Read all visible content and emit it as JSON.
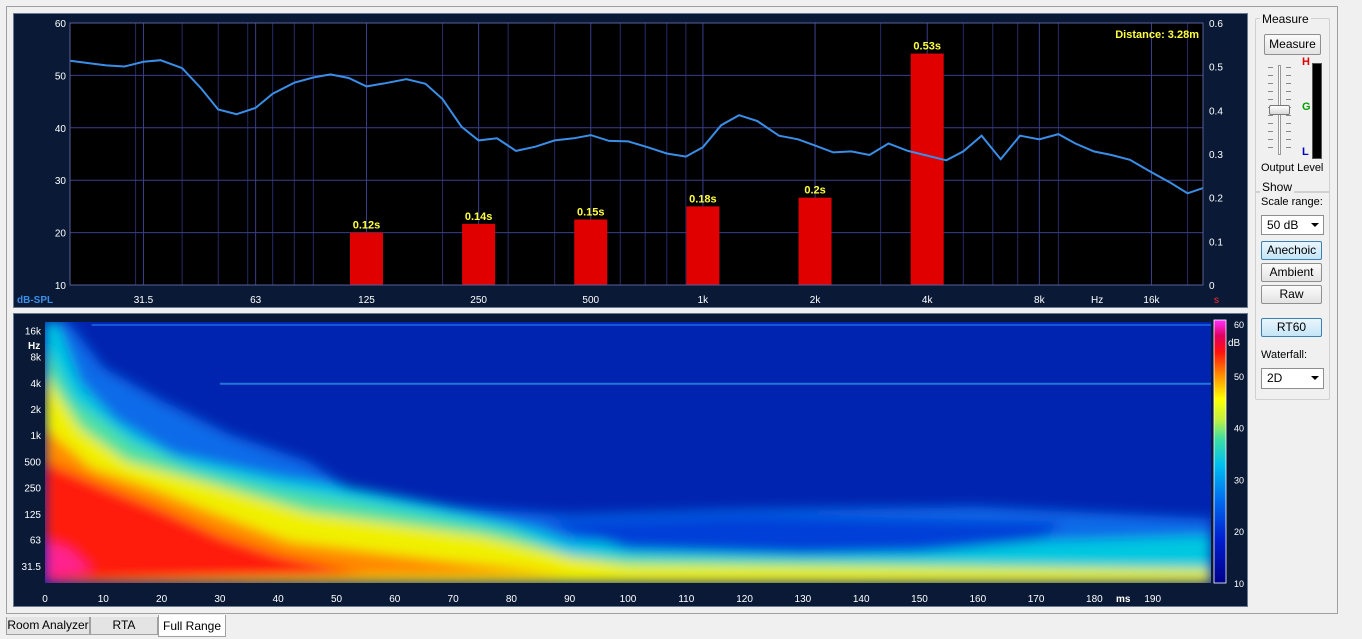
{
  "top_chart": {
    "annotation": "Distance: 3.28m",
    "left_unit": "dB-SPL",
    "freq_unit": "Hz",
    "right_unit": "s",
    "left_ticks": [
      "60",
      "50",
      "40",
      "30",
      "20",
      "10"
    ],
    "right_ticks": [
      "0.6",
      "0.5",
      "0.4",
      "0.3",
      "0.2",
      "0.1",
      "0"
    ],
    "freq_ticks": [
      "31.5",
      "63",
      "125",
      "250",
      "500",
      "1k",
      "2k",
      "4k",
      "8k",
      "16k"
    ]
  },
  "chart_data": [
    {
      "type": "line",
      "xscale": "log",
      "xlim": [
        20,
        22000
      ],
      "ylim": [
        10,
        60
      ],
      "x": [
        20,
        25,
        28,
        31.5,
        35,
        40,
        45,
        50,
        56,
        63,
        70,
        80,
        90,
        100,
        112,
        125,
        140,
        160,
        180,
        200,
        225,
        250,
        280,
        315,
        355,
        400,
        450,
        500,
        560,
        630,
        710,
        800,
        900,
        1000,
        1120,
        1250,
        1400,
        1600,
        1800,
        2000,
        2240,
        2500,
        2800,
        3150,
        3550,
        4000,
        4500,
        5000,
        5600,
        6300,
        7100,
        8000,
        9000,
        10000,
        11200,
        12500,
        14000,
        16000,
        18000,
        20000,
        22000
      ],
      "y": [
        52.8,
        51.9,
        51.7,
        52.6,
        52.9,
        51.4,
        47.5,
        43.5,
        42.6,
        43.8,
        46.5,
        48.6,
        49.6,
        50.2,
        49.5,
        47.9,
        48.5,
        49.3,
        48.4,
        45.5,
        40.2,
        37.6,
        38.0,
        35.6,
        36.4,
        37.6,
        38.0,
        38.6,
        37.5,
        37.4,
        36.3,
        35.1,
        34.5,
        36.3,
        40.5,
        42.4,
        41.3,
        38.5,
        37.8,
        36.6,
        35.3,
        35.5,
        34.8,
        37.0,
        35.6,
        34.7,
        33.8,
        35.5,
        38.5,
        34.0,
        38.5,
        37.8,
        38.8,
        37.0,
        35.5,
        34.8,
        33.9,
        31.5,
        29.5,
        27.5,
        28.5
      ]
    },
    {
      "type": "bar",
      "categories": [
        "125",
        "250",
        "500",
        "1k",
        "2k",
        "4k"
      ],
      "values": [
        0.12,
        0.14,
        0.15,
        0.18,
        0.2,
        0.53
      ],
      "labels": [
        "0.12s",
        "0.14s",
        "0.15s",
        "0.18s",
        "0.2s",
        "0.53s"
      ],
      "ylim": [
        0,
        0.6
      ],
      "ylabel": "s"
    },
    {
      "type": "heatmap",
      "x_unit": "ms",
      "y_unit": "Hz",
      "color_unit": "dB",
      "xlim": [
        0,
        200
      ],
      "ylim": [
        20,
        20000
      ],
      "color_range": [
        10,
        60
      ],
      "x_ticks": [
        "0",
        "10",
        "20",
        "30",
        "40",
        "50",
        "60",
        "70",
        "80",
        "90",
        "100",
        "110",
        "120",
        "130",
        "140",
        "150",
        "160",
        "170",
        "180",
        "190"
      ],
      "y_ticks": [
        "16k",
        "8k",
        "4k",
        "2k",
        "1k",
        "500",
        "250",
        "125",
        "63",
        "31.5"
      ],
      "color_ticks": [
        "60",
        "50",
        "40",
        "30",
        "20",
        "10"
      ]
    }
  ],
  "bottom_chart": {
    "time_unit": "ms",
    "freq_unit": "Hz",
    "scale_unit": "dB",
    "time_ticks": [
      "0",
      "10",
      "20",
      "30",
      "40",
      "50",
      "60",
      "70",
      "80",
      "90",
      "100",
      "110",
      "120",
      "130",
      "140",
      "150",
      "160",
      "170",
      "180",
      "190"
    ],
    "freq_ticks": [
      "16k",
      "8k",
      "4k",
      "2k",
      "1k",
      "500",
      "250",
      "125",
      "63",
      "31.5"
    ],
    "scale_ticks": [
      "60",
      "50",
      "40",
      "30",
      "20",
      "10"
    ]
  },
  "sidebar": {
    "measure_group": "Measure",
    "measure_button": "Measure",
    "meter_high": "H",
    "meter_good": "G",
    "meter_low": "L",
    "output_level": "Output Level",
    "show_group": "Show",
    "scale_range_label": "Scale range:",
    "scale_range_value": "50 dB",
    "anechoic": "Anechoic",
    "ambient": "Ambient",
    "raw": "Raw",
    "rt60": "RT60",
    "waterfall_label": "Waterfall:",
    "waterfall_value": "2D",
    "output_level_fraction": 0.5
  },
  "tabs": [
    "Room Analyzer",
    "RTA",
    "Full Range"
  ],
  "colors": {
    "panel_bg": "#0a1a36",
    "plot_bg": "#000000",
    "grid": "#3a3f8a",
    "curve": "#3a8ee8",
    "bar": "#e00000",
    "bar_label": "#ffff40",
    "annotation": "#ffff40",
    "unit_label": "#3a8ee8",
    "right_unit": "#ff3030"
  }
}
